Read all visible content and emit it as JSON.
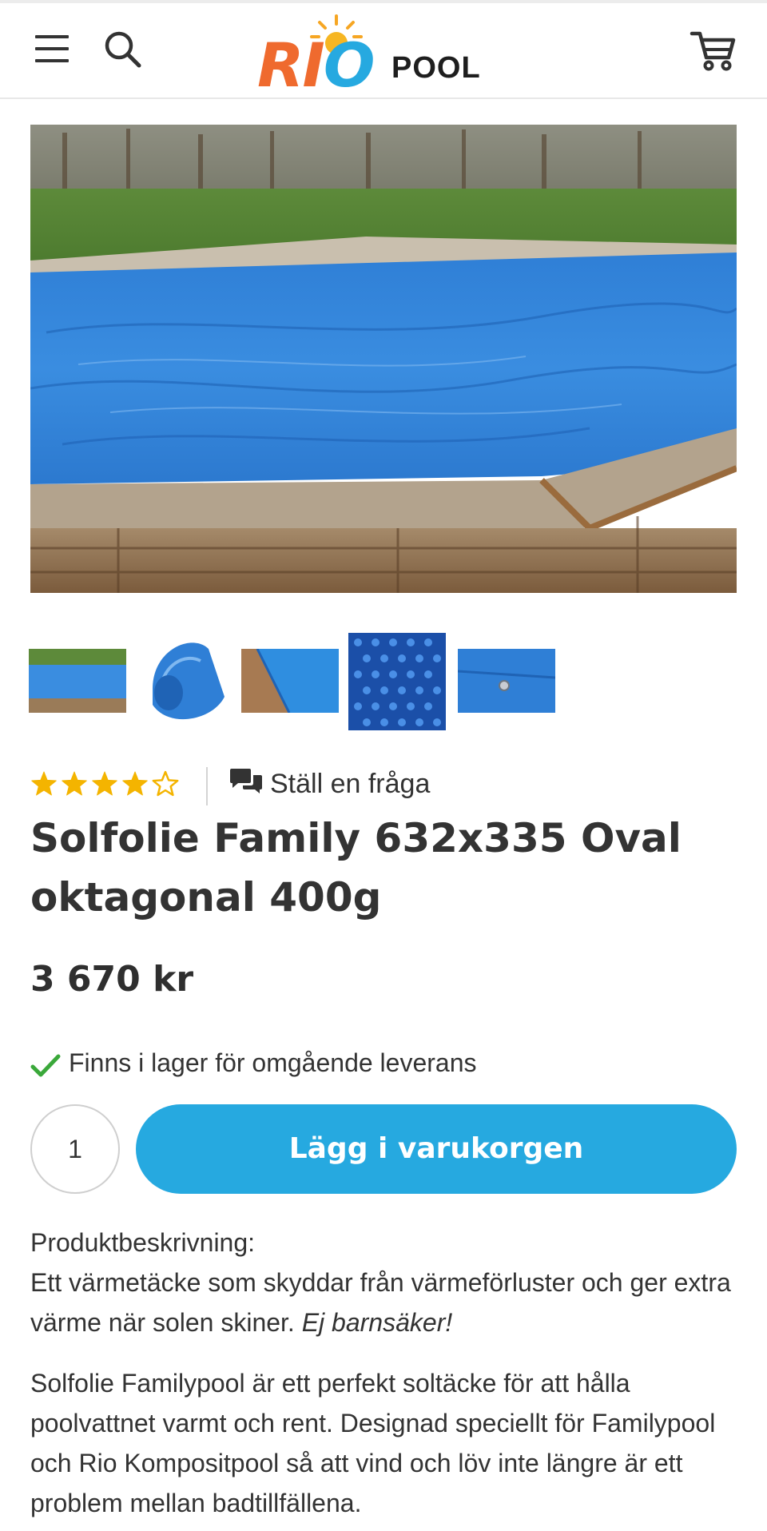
{
  "header": {
    "menu_icon": "hamburger-menu-icon",
    "search_icon": "search-icon",
    "cart_icon": "cart-icon",
    "logo": {
      "word1": "RIO",
      "word2": "POOL",
      "accent_orange": "#ef6a2e",
      "accent_blue": "#26a9e0"
    }
  },
  "gallery": {
    "thumbnail_count": 5
  },
  "product": {
    "rating": 4,
    "rating_max": 5,
    "ask_label": "Ställ en fråga",
    "ask_icon": "chat-bubbles-icon",
    "title": "Solfolie Family 632x335 Oval oktagonal 400g",
    "price": "3 670 kr",
    "stock_text": "Finns i lager för omgående leverans",
    "stock_icon": "checkmark-icon",
    "stock_color": "#3aa83a",
    "quantity": "1",
    "add_to_cart_label": "Lägg i varukorgen",
    "button_color": "#26a9e0"
  },
  "description": {
    "heading": "Produktbeskrivning:",
    "para1": "Ett värmetäcke som skyddar från värmeförluster och ger extra värme när solen skiner.",
    "para1_italic": "Ej barnsäker!",
    "para2": "Solfolie Familypool är ett perfekt soltäcke för att hålla poolvattnet varmt och rent. Designad speciellt för Familypool och Rio Kompositpool så att vind och löv inte längre är ett problem mellan badtillfällena."
  }
}
